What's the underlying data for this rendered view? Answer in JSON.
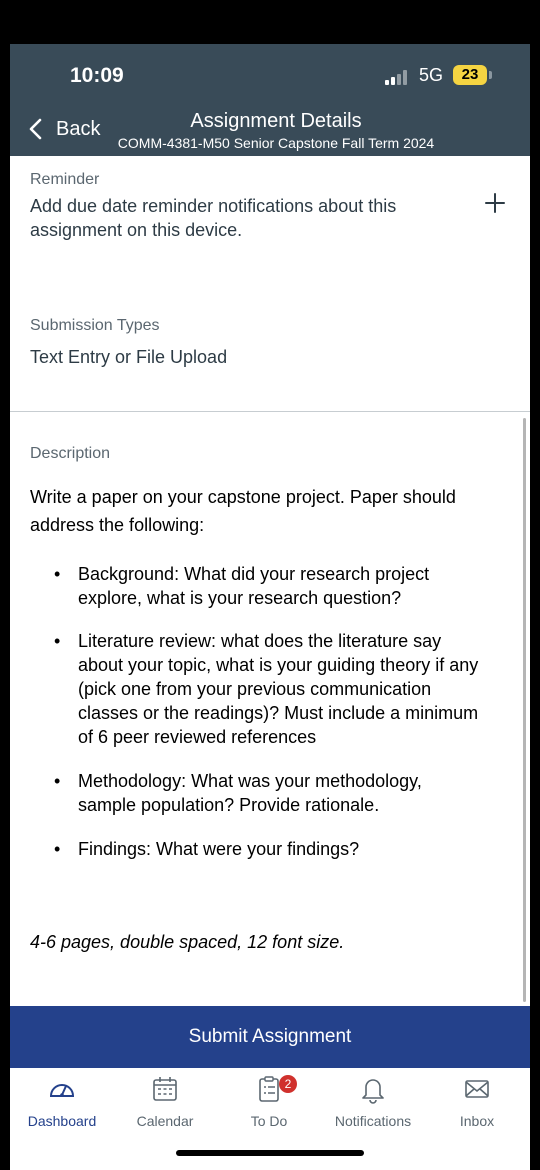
{
  "status": {
    "time": "10:09",
    "network": "5G",
    "battery": "23"
  },
  "nav": {
    "back_label": "Back",
    "title": "Assignment Details",
    "subtitle": "COMM-4381-M50 Senior Capstone Fall Term 2024"
  },
  "reminder": {
    "label": "Reminder",
    "text_line1": "Add due date reminder notifications about this",
    "text_line2": "assignment on this device."
  },
  "submission": {
    "label": "Submission Types",
    "value": "Text Entry or File Upload"
  },
  "description": {
    "label": "Description",
    "intro_line1": "Write a paper on your capstone project. Paper should",
    "intro_line2": "address the following:",
    "bullets": [
      [
        "Background: What did your research project",
        "explore, what is your research question?"
      ],
      [
        "Literature review: what does the literature say",
        "about your topic, what is your guiding theory if any",
        "(pick one from your previous communication",
        "classes or the readings)? Must include a minimum",
        "of 6 peer reviewed references"
      ],
      [
        "Methodology: What was your methodology,",
        "sample population? Provide rationale."
      ],
      [
        "Findings: What were your findings?"
      ]
    ],
    "note": "4-6 pages, double spaced, 12 font size."
  },
  "submit_label": "Submit Assignment",
  "tabs": [
    {
      "label": "Dashboard",
      "icon": "dashboard-icon"
    },
    {
      "label": "Calendar",
      "icon": "calendar-icon"
    },
    {
      "label": "To Do",
      "icon": "todo-icon",
      "badge": "2"
    },
    {
      "label": "Notifications",
      "icon": "bell-icon"
    },
    {
      "label": "Inbox",
      "icon": "mail-icon"
    }
  ],
  "colors": {
    "header": "#394b58",
    "primary": "#24418b",
    "badge": "#d0312d",
    "battery": "#f5d442"
  }
}
